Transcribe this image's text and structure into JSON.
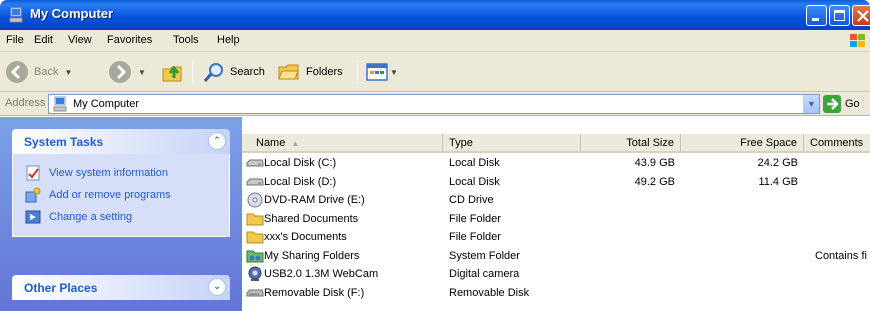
{
  "window": {
    "title": "My Computer"
  },
  "menu": [
    "File",
    "Edit",
    "View",
    "Favorites",
    "Tools",
    "Help"
  ],
  "toolbar": {
    "back": "Back",
    "search": "Search",
    "folders": "Folders"
  },
  "address": {
    "label": "Address",
    "value": "My Computer",
    "go": "Go"
  },
  "tasks": {
    "system_title": "System Tasks",
    "items": [
      {
        "label": "View system information",
        "icon": "system-info-icon"
      },
      {
        "label": "Add or remove programs",
        "icon": "add-remove-programs-icon"
      },
      {
        "label": "Change a setting",
        "icon": "control-panel-icon"
      }
    ],
    "other_title": "Other Places"
  },
  "columns": [
    "Name",
    "Type",
    "Total Size",
    "Free Space",
    "Comments"
  ],
  "items": [
    {
      "name": "Local Disk (C:)",
      "type": "Local Disk",
      "total": "43.9 GB",
      "free": "24.2 GB",
      "comments": "",
      "icon": "hard-disk-icon"
    },
    {
      "name": "Local Disk (D:)",
      "type": "Local Disk",
      "total": "49.2 GB",
      "free": "11.4 GB",
      "comments": "",
      "icon": "hard-disk-icon"
    },
    {
      "name": "DVD-RAM Drive (E:)",
      "type": "CD Drive",
      "total": "",
      "free": "",
      "comments": "",
      "icon": "dvd-drive-icon"
    },
    {
      "name": "Shared Documents",
      "type": "File Folder",
      "total": "",
      "free": "",
      "comments": "",
      "icon": "folder-icon"
    },
    {
      "name": "xxx's Documents",
      "type": "File Folder",
      "total": "",
      "free": "",
      "comments": "",
      "icon": "folder-icon"
    },
    {
      "name": "My Sharing Folders",
      "type": "System Folder",
      "total": "",
      "free": "",
      "comments": "Contains fi",
      "icon": "sharing-folder-icon"
    },
    {
      "name": "USB2.0 1.3M WebCam",
      "type": "Digital camera",
      "total": "",
      "free": "",
      "comments": "",
      "icon": "webcam-icon"
    },
    {
      "name": "Removable Disk (F:)",
      "type": "Removable Disk",
      "total": "",
      "free": "",
      "comments": "",
      "icon": "removable-disk-icon"
    }
  ],
  "colors": {
    "title_bar": "#0855dd",
    "task_pane": "#6f8fe0",
    "link": "#215dc6"
  }
}
